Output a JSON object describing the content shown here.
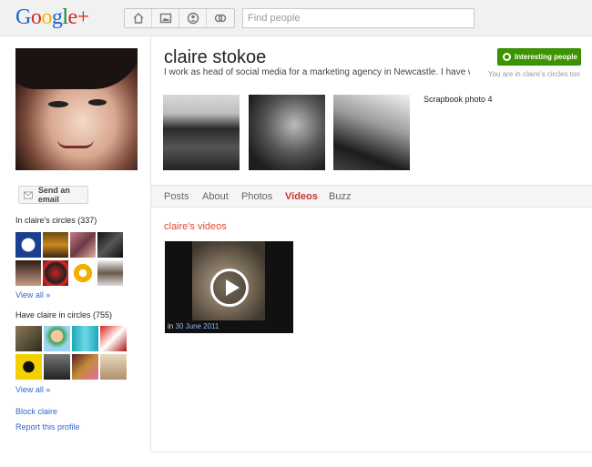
{
  "app": {
    "logo": "Google+",
    "nav_icons": [
      "home-icon",
      "photos-icon",
      "profile-icon",
      "circles-icon"
    ],
    "search_placeholder": "Find people"
  },
  "colors": {
    "accent_red": "#dd4b39",
    "link_blue": "#3366cc",
    "green_button": "#3d9400",
    "topbar": "#f1f1f1"
  },
  "sidebar": {
    "send_email_label": "Send an email",
    "in_circles_title": "In claire's circles (337)",
    "in_circles_view_all": "View all »",
    "have_in_circles_title": "Have claire in circles (755)",
    "have_in_circles_view_all": "View all »",
    "block_label": "Block claire",
    "report_label": "Report this profile"
  },
  "profile": {
    "name": "claire stokoe",
    "tagline": "I work as head of social media for a marketing agency in Newcastle. I have wc",
    "interesting_button": "Interesting people",
    "circle_status": "You are in claire's circles too",
    "scrapbook_label": "Scrapbook photo 4"
  },
  "tabs": [
    {
      "label": "Posts",
      "active": false
    },
    {
      "label": "About",
      "active": false
    },
    {
      "label": "Photos",
      "active": false
    },
    {
      "label": "Videos",
      "active": true
    },
    {
      "label": "Buzz",
      "active": false
    }
  ],
  "videos": {
    "title": "claire's videos",
    "items": [
      {
        "caption_prefix": "in",
        "date": "30 June 2011"
      }
    ]
  }
}
